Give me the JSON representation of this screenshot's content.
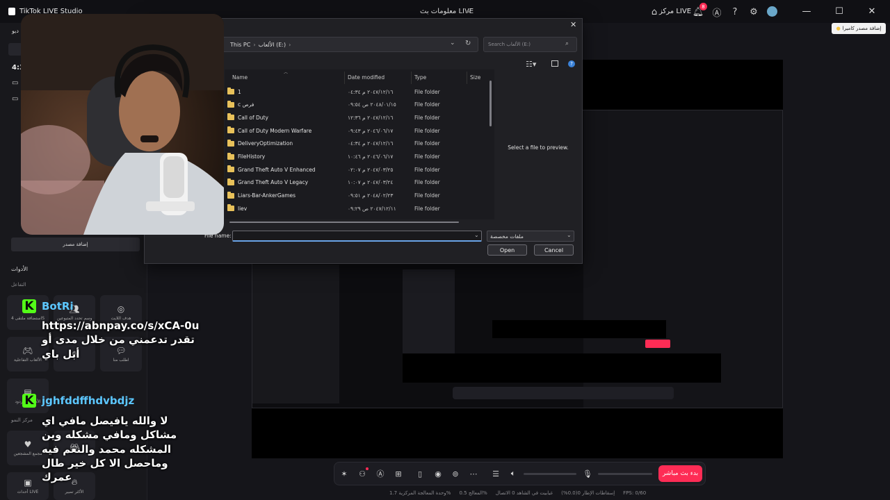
{
  "titlebar": {
    "app_name": "TikTok LIVE Studio",
    "center_title": "معلومات بث LIVE",
    "live_center_label": "مركز LIVE",
    "notification_count": "8",
    "minimize": "—",
    "maximize": "☐",
    "close": "✕"
  },
  "add_camera_tooltip": "إضافة مصدر كاميرا",
  "left_panel": {
    "partial_header": "ديو",
    "partial_value": "4:3",
    "add_source_button": "إضافة مصدر",
    "tools_title": "الأدوات",
    "interaction_section": "التفاعل",
    "tiles_row1": [
      {
        "label": "استضافة ملتقى 4S",
        "icon": "multi-guest-icon"
      },
      {
        "label": "وسم تحدد المتبوعين",
        "icon": "users-icon"
      },
      {
        "label": "هدف اللايت",
        "icon": "target-icon"
      }
    ],
    "tiles_row2": [
      {
        "label": "الألعاب التفاعلية",
        "icon": "gamepad-icon"
      },
      {
        "label": "",
        "icon": "hand-icon"
      },
      {
        "label": "اطلب منا",
        "icon": "ask-icon"
      }
    ],
    "tile_row3_label": "الأسئلة والردود",
    "growth_center": "مركز النمو",
    "tiles_row4": [
      {
        "label": "مجمع المشجعين",
        "icon": "heart-icon"
      },
      {
        "label": "",
        "icon": "gift-icon"
      }
    ],
    "tiles_row5": [
      {
        "label": "أحداث LIVE",
        "icon": "events-icon"
      },
      {
        "label": "الأكثر تمبير",
        "icon": "flame-icon"
      }
    ]
  },
  "file_dialog": {
    "breadcrumb": [
      "This PC",
      "الألعاب (E:)"
    ],
    "search_placeholder": "Search الألعاب (E:)",
    "columns": {
      "name": "Name",
      "date": "Date modified",
      "type": "Type",
      "size": "Size"
    },
    "rows": [
      {
        "name": "1",
        "date": "٢٠٤٧/١٢/١٦ م ٠٤:٣٤",
        "type": "File folder"
      },
      {
        "name": "c فرص",
        "date": "٢٠٤٨/٠١/١٥ ص ٠٩:٥٤",
        "type": "File folder"
      },
      {
        "name": "Call of Duty",
        "date": "٢٠٤٧/١٢/١٦ م ١٢:٣٦",
        "type": "File folder"
      },
      {
        "name": "Call of Duty Modern Warfare",
        "date": "٢٠٤٦/٠٦/١٧ م ٠٩:٤٣",
        "type": "File folder"
      },
      {
        "name": "DeliveryOptimization",
        "date": "٢٠٤٧/١٢/١٦ م ٠٤:٣٤",
        "type": "File folder"
      },
      {
        "name": "FileHistory",
        "date": "٢٠٤٦/٠٦/١٧ م ١٠:٤٦",
        "type": "File folder"
      },
      {
        "name": "Grand Theft Auto V Enhanced",
        "date": "٢٠٤٧/٠٣/٢٥ م ٠٢:٠٧",
        "type": "File folder"
      },
      {
        "name": "Grand Theft Auto V Legacy",
        "date": "٢٠٤٧/٠٣/٢٤ م ١٠:٠٧",
        "type": "File folder"
      },
      {
        "name": "Liars-Bar-AnkerGames",
        "date": "٢٠٤٨/٠٢/٢٣ م ٠٩:٥١",
        "type": "File folder"
      },
      {
        "name": "liev",
        "date": "٢٠٤٧/١٢/١١ ص ٠٩:٢٩",
        "type": "File folder"
      }
    ],
    "preview_text": "Select a file to preview.",
    "file_name_label": "File name:",
    "file_name_value": "",
    "filter_value": "ملفات مخصصة",
    "open_button": "Open",
    "cancel_button": "Cancel"
  },
  "chat": [
    {
      "user": "BotRix",
      "user_visible": "BotRi",
      "message": "https://abnpay.co/s/xCA-0u تقدر تدعمني من خلال مدى أو أبل باي"
    },
    {
      "user": "jghfddffhdvbdjz",
      "message": "لا والله يافيصل مافي اي مشاكل ومافي مشكله وين المشكله محمد والنعم فيه وماحصل الا كل خير طال عمرك"
    }
  ],
  "bottom_toolbar": {
    "go_live_button": "بدء بث مباشر"
  },
  "status_bar": {
    "fps": "FPS: 0/60",
    "dropped_frames": "إسقاطات الإطار 0(0.0%)",
    "network": "غيابيت في الشاهد 0 الاتصال",
    "cpu": "المعالج 0.5%",
    "gpu": "وحدة المعالجة المركزية 1.7%"
  },
  "colors": {
    "accent": "#fe2c55",
    "kick_green": "#53fc18",
    "chat_name": "#5cc7ff",
    "folder": "#e8c15a"
  }
}
